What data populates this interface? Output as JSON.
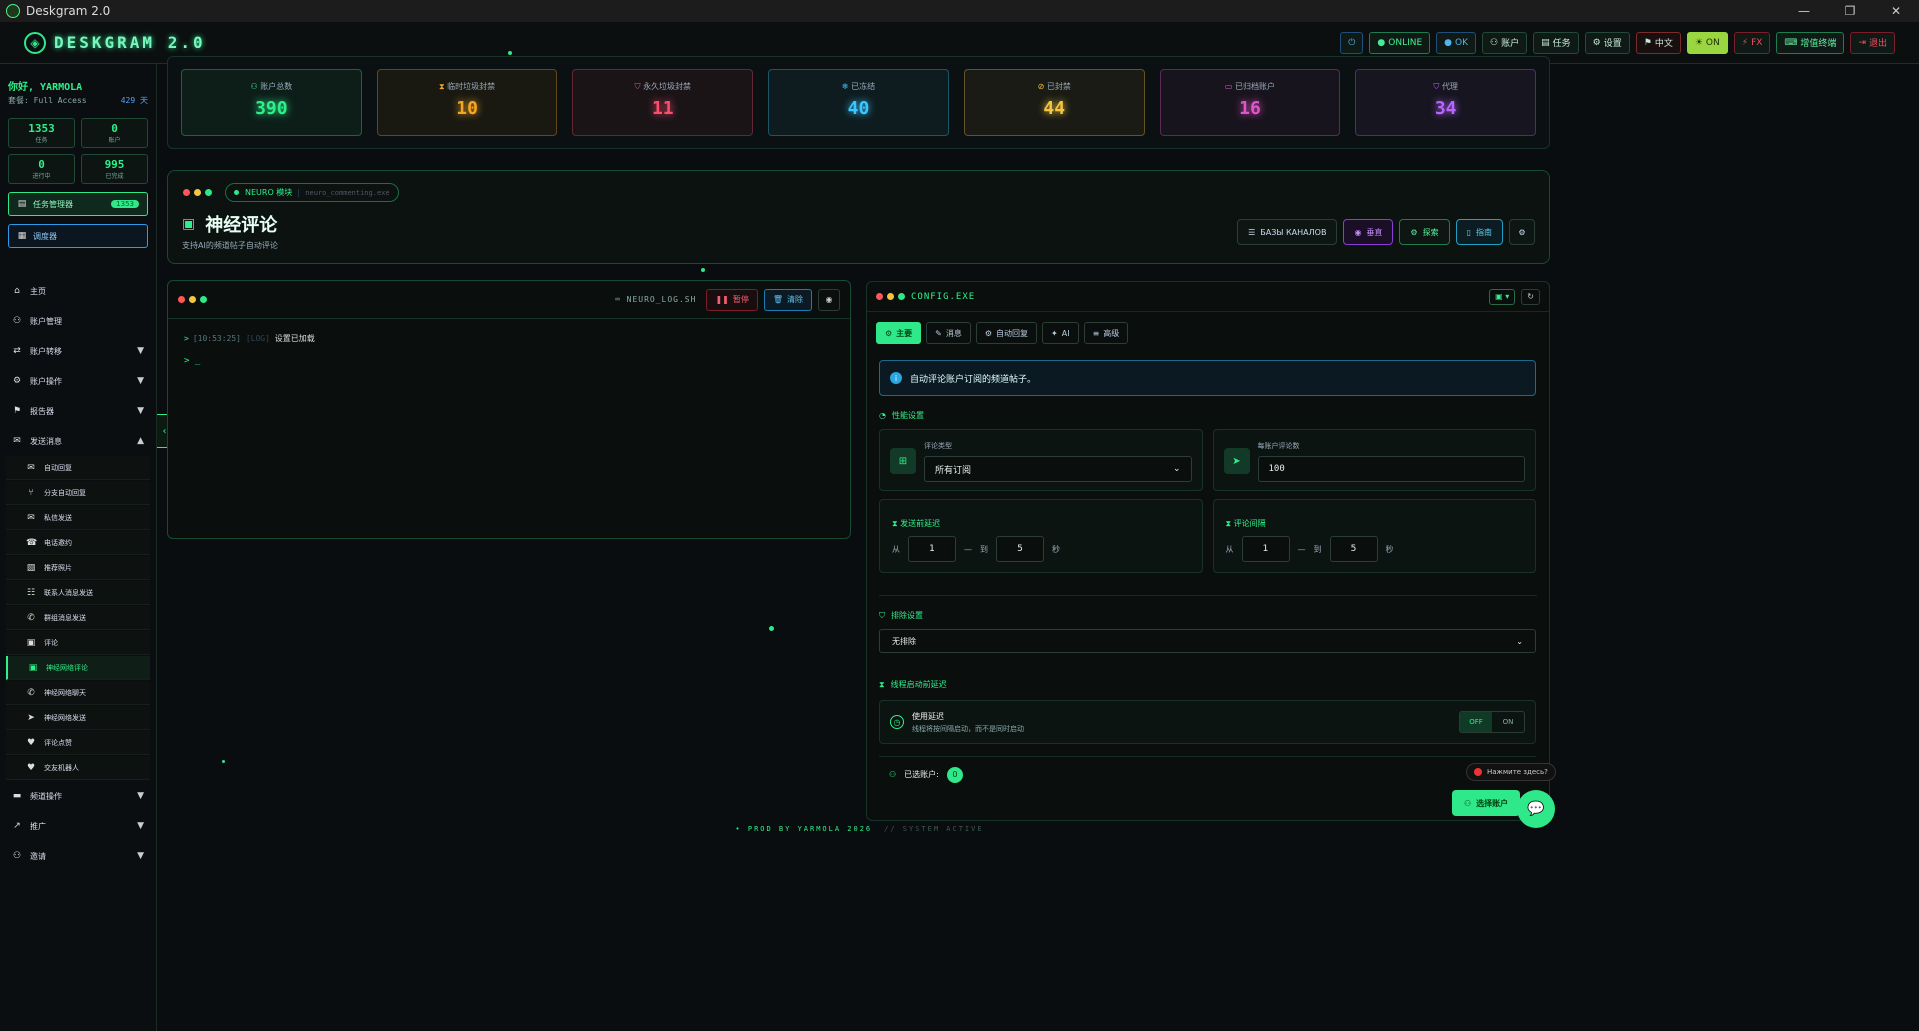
{
  "window": {
    "title": "Deskgram 2.0",
    "controls": [
      "—",
      "❐",
      "✕"
    ]
  },
  "topbar": {
    "logo": "DESKGRAM 2.0",
    "buttons": [
      {
        "label": "",
        "icon": "power-icon",
        "style": "blue"
      },
      {
        "label": "ONLINE",
        "icon": "dot-icon",
        "style": "green"
      },
      {
        "label": "OK",
        "icon": "dot-icon",
        "style": "blue"
      },
      {
        "label": "账户",
        "icon": "users-icon",
        "style": ""
      },
      {
        "label": "任务",
        "icon": "clipboard-icon",
        "style": ""
      },
      {
        "label": "设置",
        "icon": "gear-icon",
        "style": ""
      },
      {
        "label": "中文",
        "icon": "flag-icon",
        "style": "lang"
      },
      {
        "label": "ON",
        "icon": "sun-icon",
        "style": "yel"
      },
      {
        "label": "FX",
        "icon": "bolt-icon",
        "style": "red"
      },
      {
        "label": "增值终端",
        "icon": "terminal-icon",
        "style": "ai"
      },
      {
        "label": "退出",
        "icon": "logout-icon",
        "style": "red"
      }
    ]
  },
  "sidebar": {
    "greeting": "你好, YARMOLA",
    "access": "套餐: Full Access",
    "days": "429 天",
    "stats": [
      {
        "value": "1353",
        "label": "任务"
      },
      {
        "value": "0",
        "label": "账户"
      },
      {
        "value": "0",
        "label": "进行中"
      },
      {
        "value": "995",
        "label": "已完成"
      }
    ],
    "tasks_button": "任务管理器",
    "tasks_badge": "1353",
    "planner_button": "调度器",
    "menu": [
      {
        "label": "主页",
        "icon": "home-icon",
        "caret": ""
      },
      {
        "label": "账户管理",
        "icon": "users-icon",
        "caret": ""
      },
      {
        "label": "账户转移",
        "icon": "user-transfer-icon",
        "caret": "▼"
      },
      {
        "label": "账户操作",
        "icon": "user-cog-icon",
        "caret": "▼"
      },
      {
        "label": "报告器",
        "icon": "flag-icon",
        "caret": "▼"
      },
      {
        "label": "发送消息",
        "icon": "chat-icon",
        "caret": "▲"
      }
    ],
    "submenu": [
      {
        "label": "自动回复",
        "icon": "envelope-icon"
      },
      {
        "label": "分支自动回复",
        "icon": "branch-icon"
      },
      {
        "label": "私信发送",
        "icon": "mail-icon"
      },
      {
        "label": "电话邀约",
        "icon": "phone-icon"
      },
      {
        "label": "推荐照片",
        "icon": "image-icon"
      },
      {
        "label": "联系人消息发送",
        "icon": "contacts-icon"
      },
      {
        "label": "群组消息发送",
        "icon": "group-chat-icon"
      },
      {
        "label": "评论",
        "icon": "comment-icon"
      },
      {
        "label": "神经网络评论",
        "icon": "comment-ai-icon",
        "active": true
      },
      {
        "label": "神经网络聊天",
        "icon": "chat-ai-icon"
      },
      {
        "label": "神经网络发送",
        "icon": "send-ai-icon"
      },
      {
        "label": "评论点赞",
        "icon": "heart-icon"
      },
      {
        "label": "交友机器人",
        "icon": "heart-icon"
      }
    ],
    "menu_bottom": [
      {
        "label": "频道操作",
        "icon": "channel-icon",
        "caret": "▼"
      },
      {
        "label": "推广",
        "icon": "chart-icon",
        "caret": "▼"
      },
      {
        "label": "邀请",
        "icon": "invite-icon",
        "caret": "▼"
      }
    ]
  },
  "stat_cards": [
    {
      "label": "账户总数",
      "value": "390",
      "color": "#2ef08a",
      "icon": "users-icon"
    },
    {
      "label": "临时垃圾封禁",
      "value": "10",
      "color": "#f5a524",
      "icon": "hourglass-icon"
    },
    {
      "label": "永久垃圾封禁",
      "value": "11",
      "color": "#ff4d6d",
      "icon": "shield-icon"
    },
    {
      "label": "已冻结",
      "value": "40",
      "color": "#38c8ff",
      "icon": "snowflake-icon"
    },
    {
      "label": "已封禁",
      "value": "44",
      "color": "#f5c542",
      "icon": "ban-icon"
    },
    {
      "label": "已归档账户",
      "value": "16",
      "color": "#e055c8",
      "icon": "archive-icon"
    },
    {
      "label": "代理",
      "value": "34",
      "color": "#b866ff",
      "icon": "shield-icon"
    }
  ],
  "neuro": {
    "module_label": "NEURO 模块",
    "module_file": "neuro_commenting.exe",
    "title": "神经评论",
    "subtitle": "支持AI的频道帖子自动评论",
    "buttons": [
      {
        "label": "БАЗЫ КАНАЛОВ",
        "icon": "database-icon",
        "style": ""
      },
      {
        "label": "垂直",
        "icon": "eye-icon",
        "style": "purple"
      },
      {
        "label": "探索",
        "icon": "robot-icon",
        "style": "green"
      },
      {
        "label": "指南",
        "icon": "book-icon",
        "style": "cyan"
      }
    ]
  },
  "log": {
    "file": "NEURO_LOG.SH",
    "pause": "暂停",
    "clear": "清除",
    "lines": [
      {
        "time": "[10:53:25]",
        "level": "[LOG]",
        "text": "设置已加载"
      }
    ],
    "prompt": "> _"
  },
  "config": {
    "title": "CONFIG.EXE",
    "tabs": [
      {
        "label": "主要",
        "icon": "gear-icon",
        "active": true
      },
      {
        "label": "消息",
        "icon": "edit-icon"
      },
      {
        "label": "自动回复",
        "icon": "robot-icon"
      },
      {
        "label": "AI",
        "icon": "spark-icon"
      },
      {
        "label": "高级",
        "icon": "sliders-icon"
      }
    ],
    "info": "自动评论账户订阅的频道帖子。",
    "perf_title": "性能设置",
    "comment_type_label": "评论类型",
    "comment_type_value": "所有订阅",
    "per_account_label": "每账户评论数",
    "per_account_value": "100",
    "send_delay_title": "发送前延迟",
    "comment_interval_title": "评论间隔",
    "from": "从",
    "to": "到",
    "sec": "秒",
    "dash": "—",
    "delay_from": "1",
    "delay_to": "5",
    "interval_from": "1",
    "interval_to": "5",
    "exclude_title": "排除设置",
    "exclude_value": "无排除",
    "thread_title": "线程启动前延迟",
    "use_delay": "使用延迟",
    "use_delay_desc": "线程将按间隔启动，而不是同时启动",
    "toggle_off": "OFF",
    "toggle_on": "ON",
    "selected_label": "已选账户:",
    "selected_count": "0",
    "select_button": "选择账户"
  },
  "recorder": "Нажмите здесь?",
  "footer": {
    "main": "• PROD BY YARMOLA 2026",
    "sys": "// SYSTEM ACTIVE"
  }
}
